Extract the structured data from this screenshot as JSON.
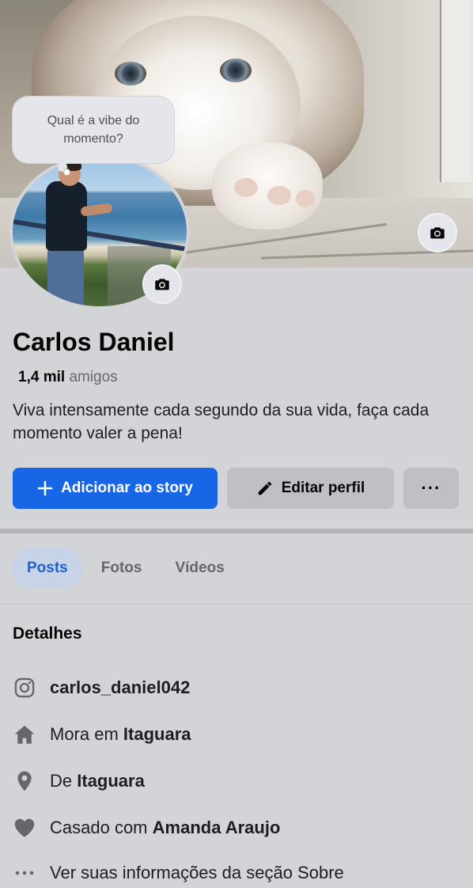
{
  "cover": {
    "camera_icon": "camera-icon"
  },
  "profile": {
    "status_prompt": "Qual é a vibe do momento?",
    "name": "Carlos Daniel",
    "friends_count": "1,4 mil",
    "friends_label": "amigos",
    "bio": "Viva intensamente cada segundo da sua vida, faça cada momento valer a pena!"
  },
  "actions": {
    "add_story": "Adicionar ao story",
    "edit_profile": "Editar perfil",
    "more": "···"
  },
  "tabs": [
    {
      "label": "Posts",
      "active": true
    },
    {
      "label": "Fotos",
      "active": false
    },
    {
      "label": "Vídeos",
      "active": false
    }
  ],
  "details": {
    "title": "Detalhes",
    "instagram": "carlos_daniel042",
    "lives_prefix": "Mora em",
    "lives_city": "Itaguara",
    "from_prefix": "De",
    "from_city": "Itaguara",
    "married_prefix": "Casado com",
    "married_to": "Amanda Araujo",
    "about_link": "Ver suas informações da seção Sobre"
  },
  "colors": {
    "primary": "#1766e6",
    "background": "#d3d4d7",
    "secondary_button": "#bec0c5",
    "active_tab": "#c7d3e7"
  }
}
